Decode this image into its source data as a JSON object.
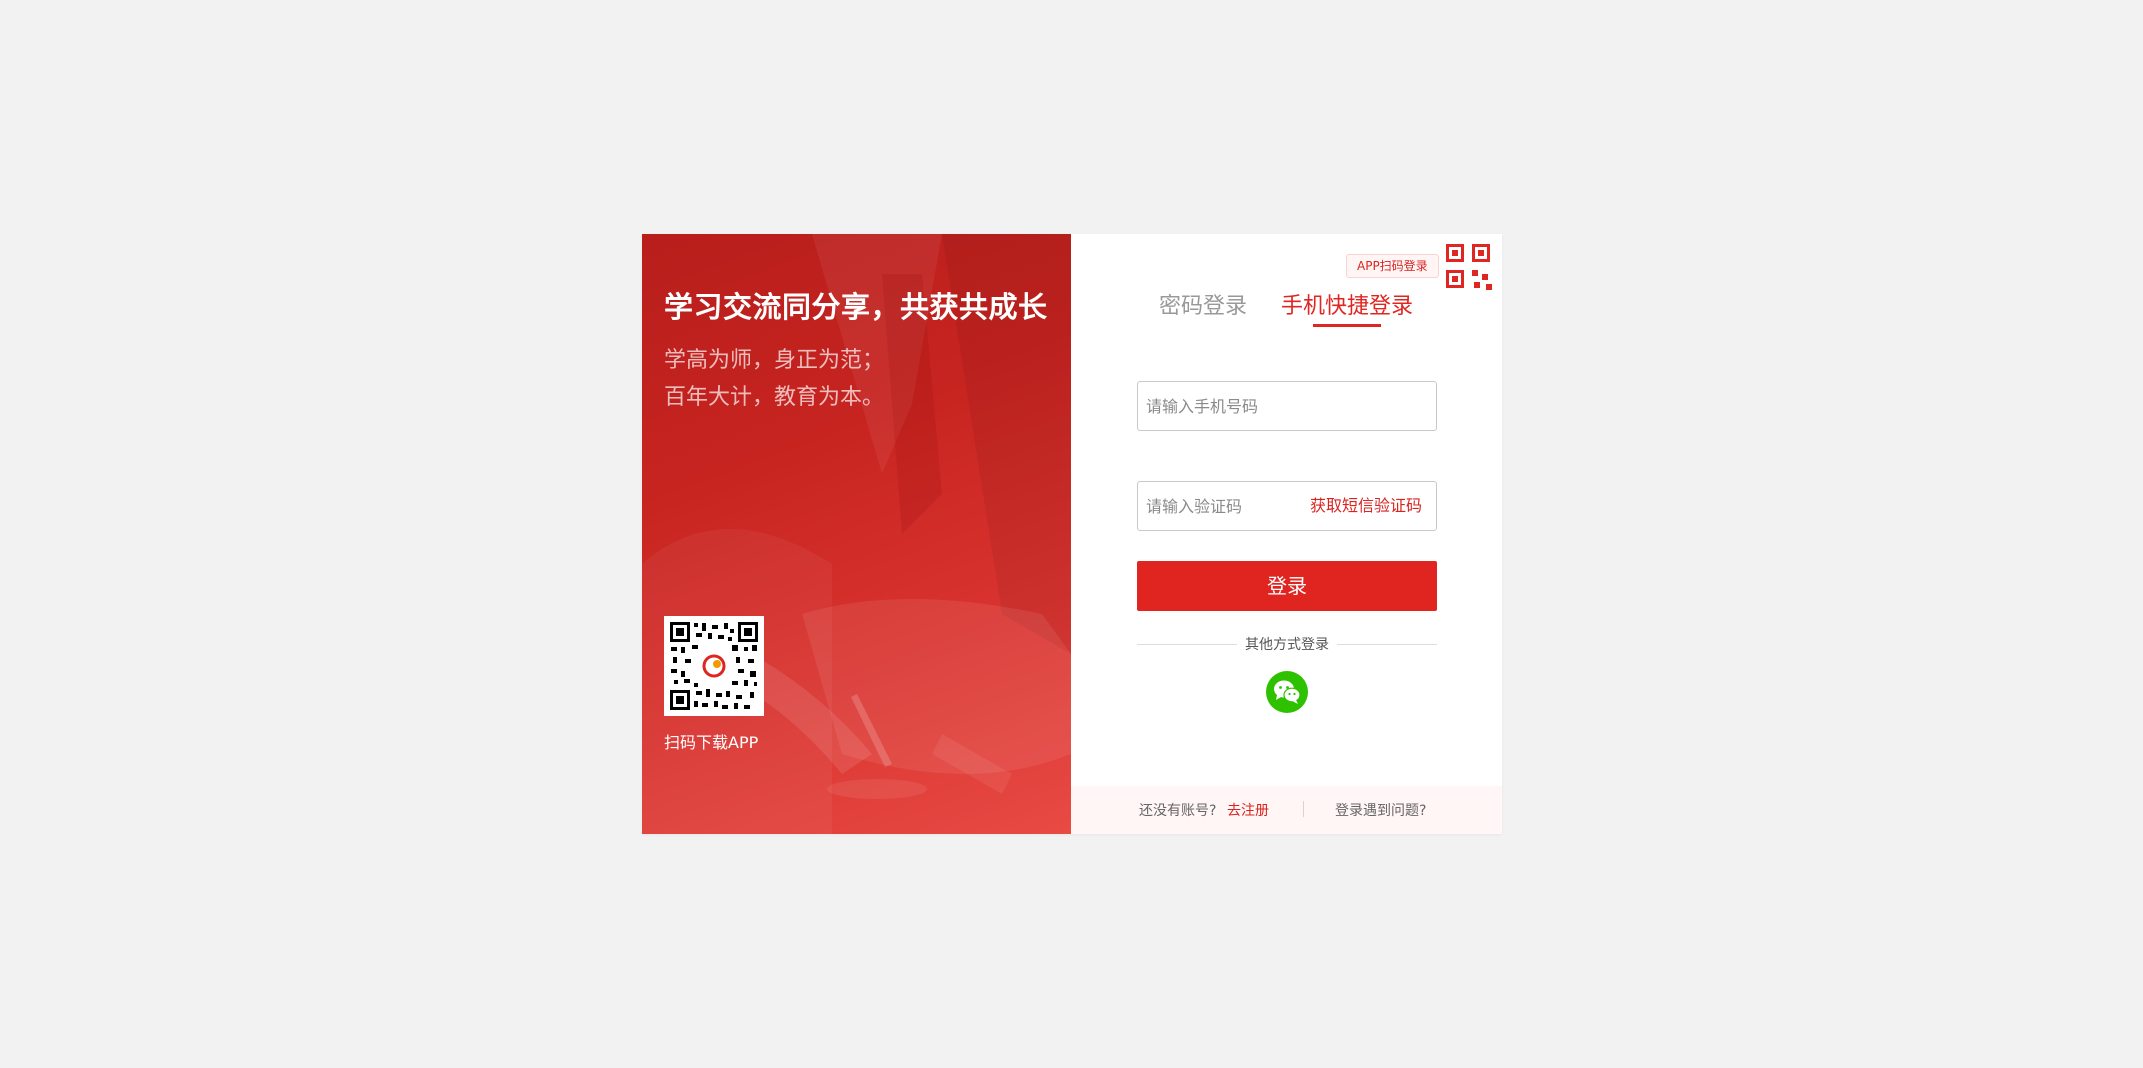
{
  "promo": {
    "title": "学习交流同分享，共获共成长",
    "motto_line1": "学高为师，身正为范；",
    "motto_line2": "百年大计，教育为本。",
    "qr_caption": "扫码下载APP"
  },
  "login": {
    "app_scan_label": "APP扫码登录",
    "tabs": [
      {
        "label": "密码登录",
        "active": false
      },
      {
        "label": "手机快捷登录",
        "active": true
      }
    ],
    "phone_placeholder": "请输入手机号码",
    "code_placeholder": "请输入验证码",
    "get_code_label": "获取短信验证码",
    "submit_label": "登录",
    "other_methods_label": "其他方式登录",
    "other_methods_icons": [
      "wechat-icon"
    ]
  },
  "footer": {
    "no_account_text": "还没有账号?",
    "register_link": "去注册",
    "problem_link": "登录遇到问题?"
  },
  "colors": {
    "accent": "#e02420",
    "wechat": "#2dc100",
    "page_bg": "#f2f2f2"
  }
}
